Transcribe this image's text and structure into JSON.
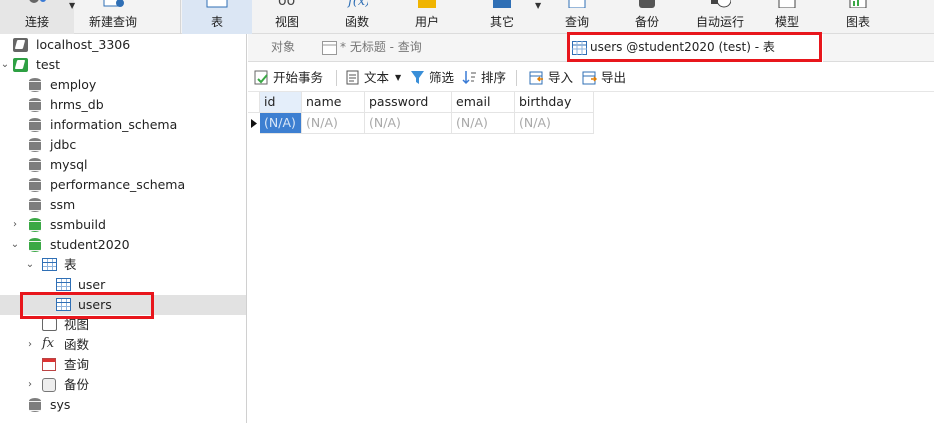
{
  "toolbar": {
    "buttons": [
      {
        "label": "连接",
        "icon": "connect-icon"
      },
      {
        "label": "新建查询",
        "icon": "new-query-icon"
      },
      {
        "label": "表",
        "icon": "table-icon"
      },
      {
        "label": "视图",
        "icon": "view-icon"
      },
      {
        "label": "函数",
        "icon": "function-icon"
      },
      {
        "label": "用户",
        "icon": "user-icon"
      },
      {
        "label": "其它",
        "icon": "other-icon"
      },
      {
        "label": "查询",
        "icon": "query-icon"
      },
      {
        "label": "备份",
        "icon": "backup-icon"
      },
      {
        "label": "自动运行",
        "icon": "automation-icon"
      },
      {
        "label": "模型",
        "icon": "model-icon"
      },
      {
        "label": "图表",
        "icon": "chart-icon"
      }
    ]
  },
  "sidebar": {
    "items": [
      {
        "label": "localhost_3306",
        "icon": "connection-icon"
      },
      {
        "label": "test",
        "icon": "connection-open-icon"
      },
      {
        "label": "employ",
        "icon": "database-icon"
      },
      {
        "label": "hrms_db",
        "icon": "database-icon"
      },
      {
        "label": "information_schema",
        "icon": "database-icon"
      },
      {
        "label": "jdbc",
        "icon": "database-icon"
      },
      {
        "label": "mysql",
        "icon": "database-icon"
      },
      {
        "label": "performance_schema",
        "icon": "database-icon"
      },
      {
        "label": "ssm",
        "icon": "database-icon"
      },
      {
        "label": "ssmbuild",
        "icon": "database-open-icon"
      },
      {
        "label": "student2020",
        "icon": "database-open-icon"
      },
      {
        "label": "表",
        "icon": "tables-folder-icon"
      },
      {
        "label": "user",
        "icon": "table-icon"
      },
      {
        "label": "users",
        "icon": "table-icon"
      },
      {
        "label": "视图",
        "icon": "views-icon"
      },
      {
        "label": "函数",
        "icon": "functions-icon"
      },
      {
        "label": "查询",
        "icon": "queries-icon"
      },
      {
        "label": "备份",
        "icon": "backups-icon"
      },
      {
        "label": "sys",
        "icon": "database-icon"
      }
    ]
  },
  "tabs": {
    "objects": "对象",
    "untitled_query": "* 无标题 - 查询",
    "active": "users @student2020 (test) - 表"
  },
  "subtoolbar": {
    "begin_transaction": "开始事务",
    "text": "文本",
    "filter": "筛选",
    "sort": "排序",
    "import": "导入",
    "export": "导出"
  },
  "grid": {
    "columns": [
      "id",
      "name",
      "password",
      "email",
      "birthday"
    ],
    "rows": [
      [
        "(N/A)",
        "(N/A)",
        "(N/A)",
        "(N/A)",
        "(N/A)"
      ]
    ]
  },
  "colors": {
    "highlight_box": "#e8161c",
    "selection": "#3d7fd1",
    "db_open": "#3aa845"
  }
}
